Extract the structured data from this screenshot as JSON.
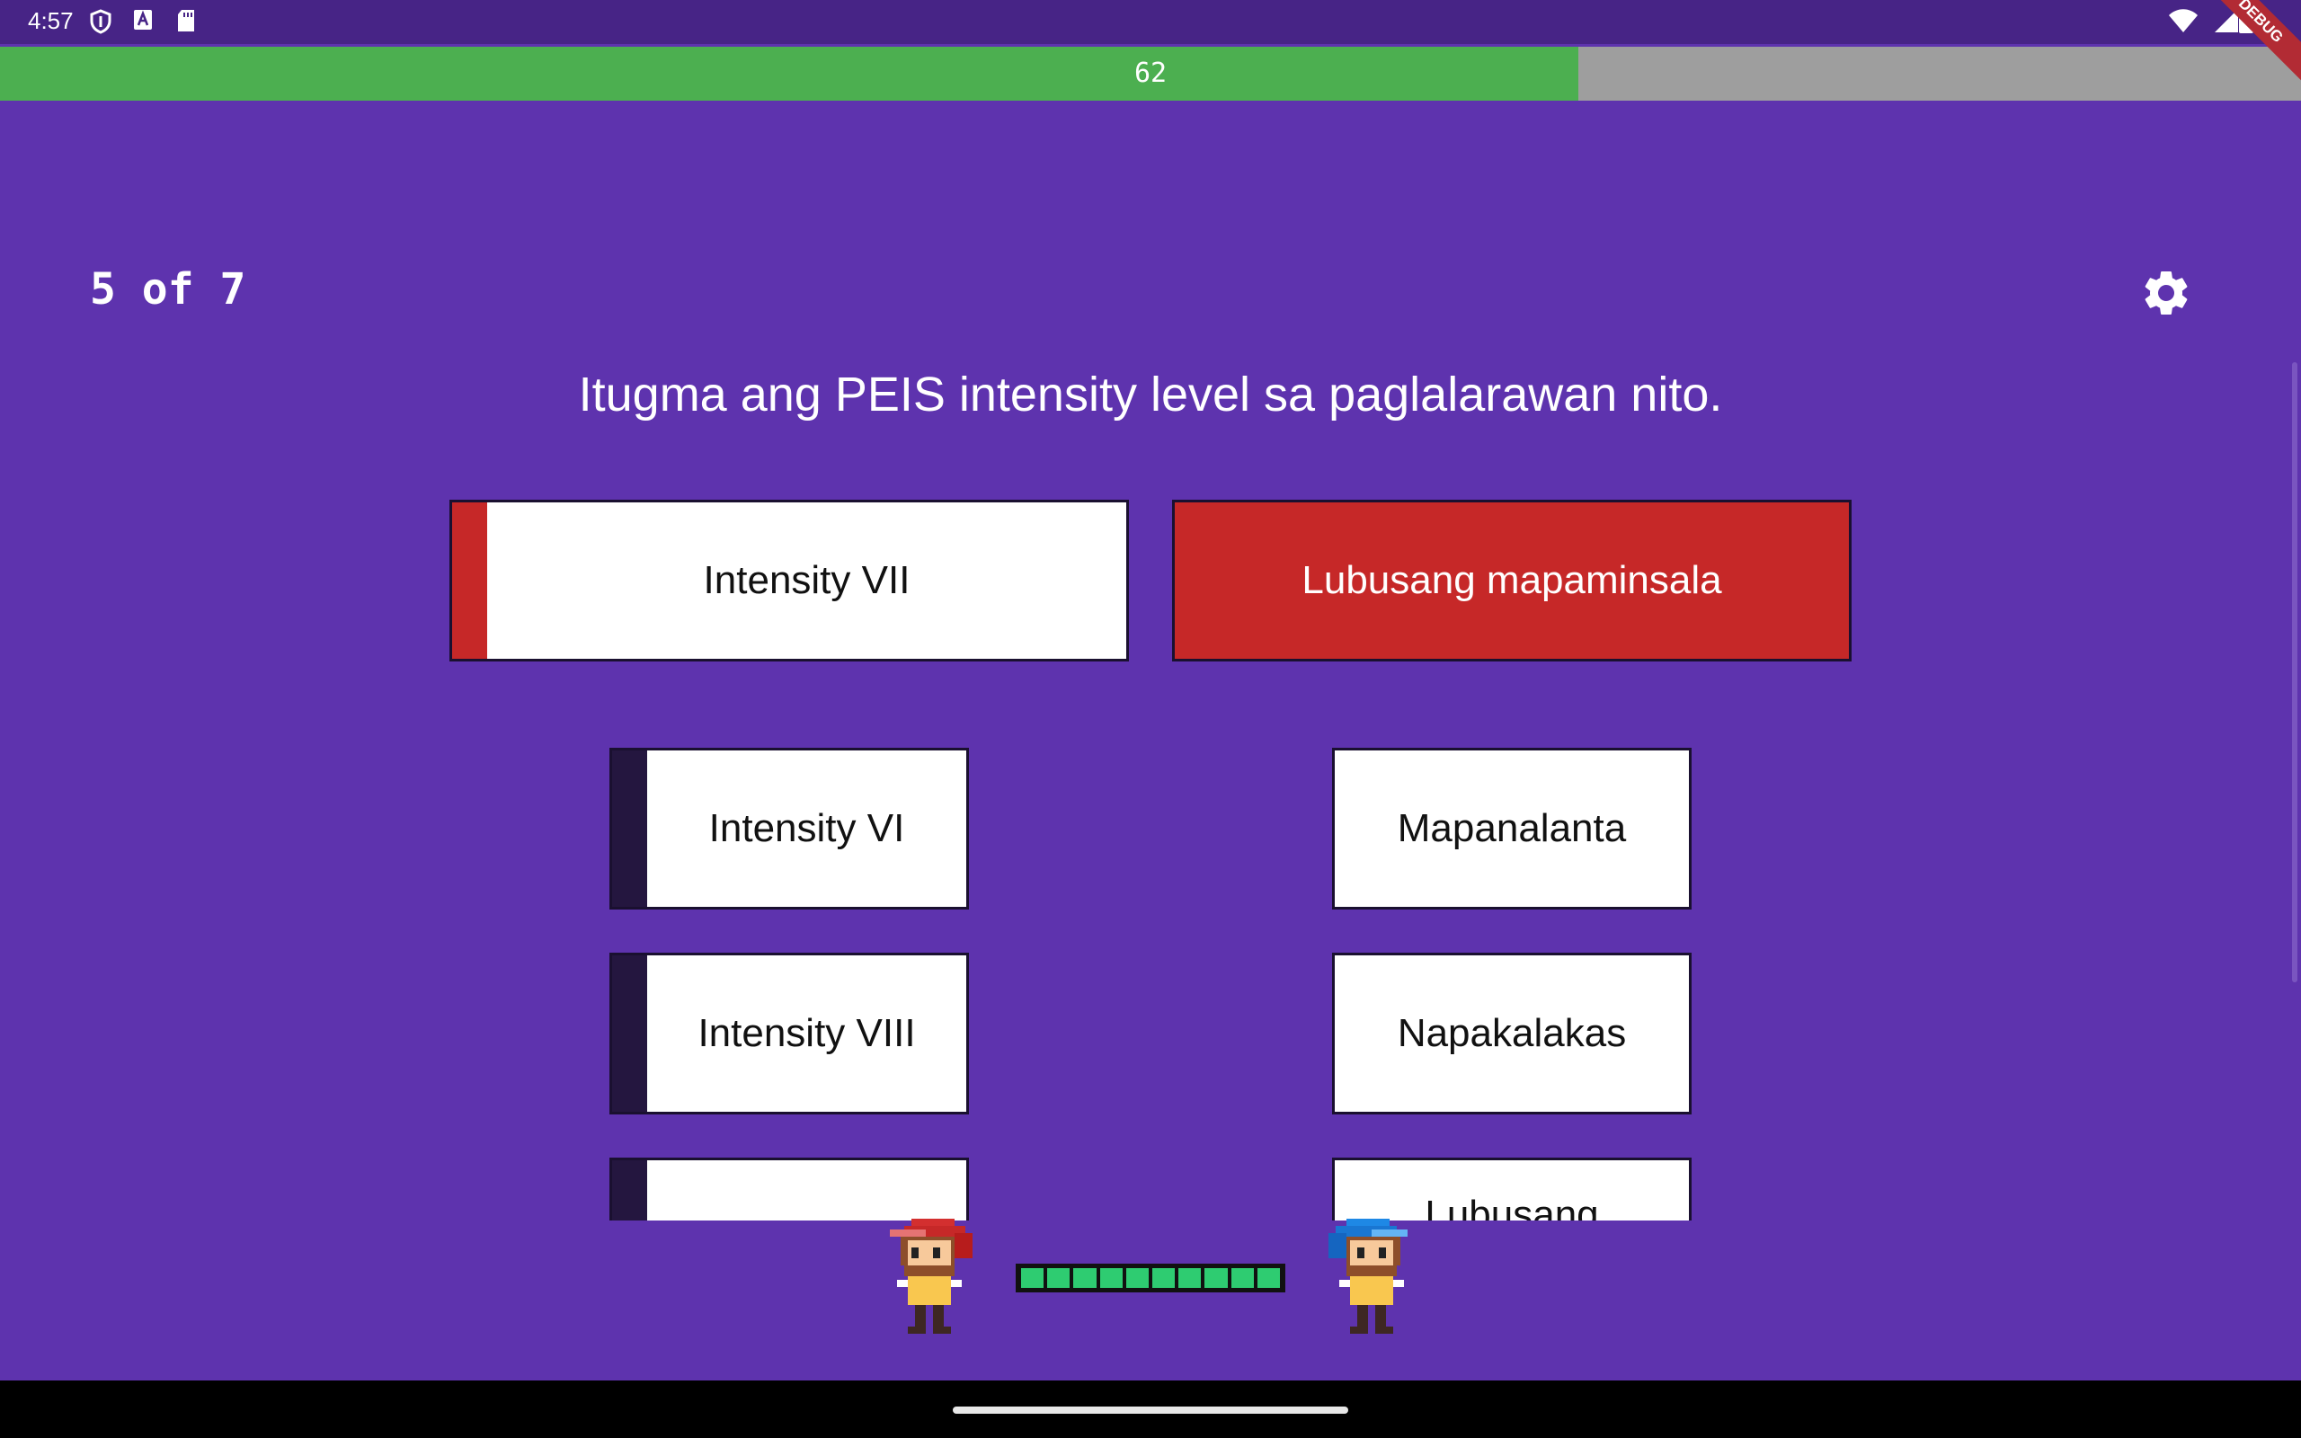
{
  "status_bar": {
    "time": "4:57",
    "left_icons": [
      "shield-icon",
      "keyboard-a-icon",
      "sd-card-icon"
    ],
    "right_icons": [
      "wifi-icon",
      "cell-signal-icon",
      "battery-icon"
    ]
  },
  "debug_banner": "DEBUG",
  "timer": {
    "value": "62",
    "fraction": 0.686,
    "fill_color": "#4caf50",
    "track_color": "#9e9e9e"
  },
  "progress": {
    "label": "5 of 7"
  },
  "settings": {
    "icon": "gear-icon"
  },
  "question": "Itugma ang PEIS intensity level sa paglalarawan nito.",
  "selected_pair": {
    "left": "Intensity VII",
    "right": "Lubusang mapaminsala",
    "color": "#c62828"
  },
  "left_options": [
    {
      "label": "Intensity VI"
    },
    {
      "label": "Intensity VIII"
    },
    {
      "label": ""
    }
  ],
  "right_options": [
    {
      "label": "Mapanalanta"
    },
    {
      "label": "Napakalakas"
    },
    {
      "label": "Lubusang"
    }
  ],
  "colors": {
    "background": "#5e33ae",
    "status_bar": "#472486",
    "unmatched_stripe": "#24163f",
    "health": "#2ecc71"
  },
  "battle": {
    "player_sprite": "red-cap-character",
    "opponent_sprite": "blue-cap-character",
    "health_segments_filled": 10,
    "health_segments_total": 10
  }
}
